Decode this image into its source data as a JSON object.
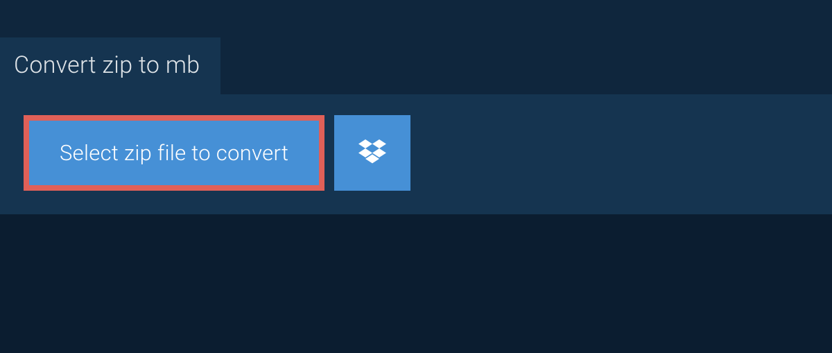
{
  "header": {
    "title": "Convert zip to mb"
  },
  "upload": {
    "select_button_label": "Select zip file to convert",
    "dropbox_icon": "dropbox-icon"
  }
}
